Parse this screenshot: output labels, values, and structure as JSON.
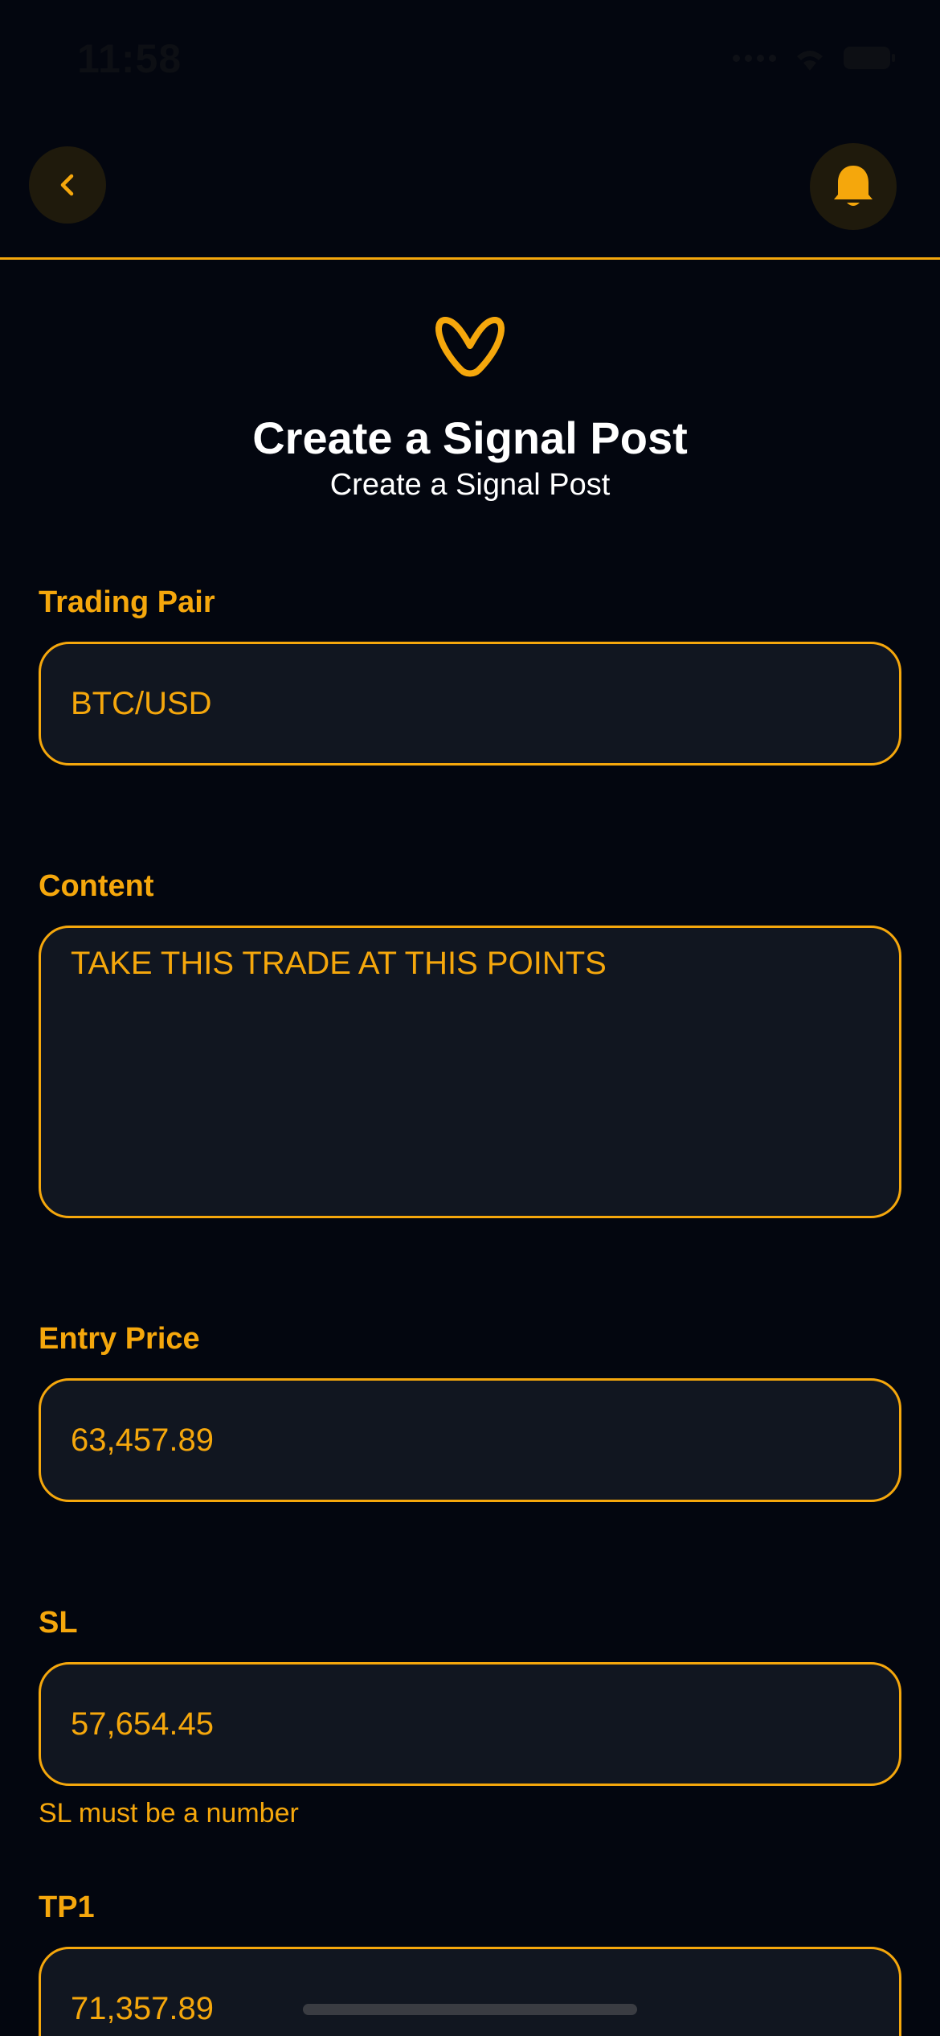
{
  "status_bar": {
    "time": "11:58"
  },
  "header": {
    "back_icon": "chevron-left-icon",
    "bell_icon": "bell-icon"
  },
  "colors": {
    "accent": "#f5a70c",
    "background": "#03060f",
    "field_background": "#111620",
    "icon_button_background": "#1f1a0c"
  },
  "page": {
    "logo_icon": "infinity-logo-icon",
    "title": "Create a Signal Post",
    "subtitle": "Create a Signal Post"
  },
  "form": {
    "trading_pair": {
      "label": "Trading Pair",
      "value": "BTC/USD"
    },
    "content": {
      "label": "Content",
      "value": "TAKE THIS TRADE AT THIS POINTS"
    },
    "entry_price": {
      "label": "Entry Price",
      "value": "63,457.89"
    },
    "sl": {
      "label": "SL",
      "value": "57,654.45",
      "error": "SL must be a number"
    },
    "tp1": {
      "label": "TP1",
      "value": "71,357.89"
    }
  }
}
